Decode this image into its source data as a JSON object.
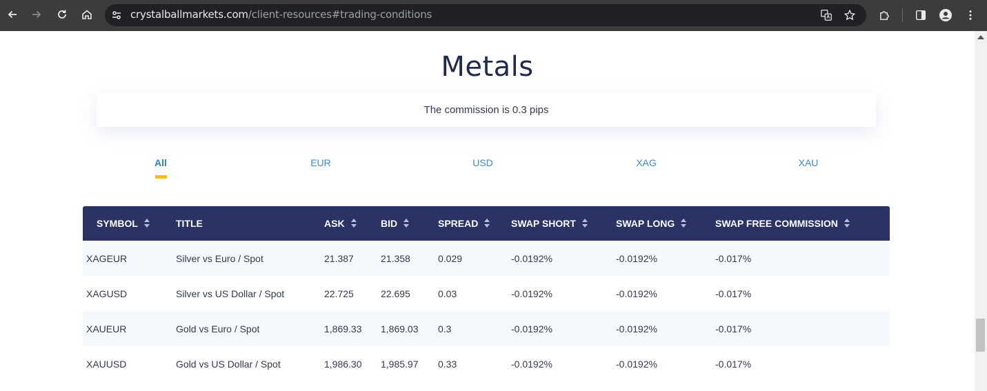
{
  "browser": {
    "url_host": "crystalballmarkets.com",
    "url_path": "/client-resources#trading-conditions"
  },
  "page": {
    "heading": "Metals",
    "commission_text": "The commission is 0.3 pips",
    "tabs": [
      {
        "label": "All",
        "active": true
      },
      {
        "label": "EUR",
        "active": false
      },
      {
        "label": "USD",
        "active": false
      },
      {
        "label": "XAG",
        "active": false
      },
      {
        "label": "XAU",
        "active": false
      }
    ],
    "accent_color": "#f3c211",
    "header_color": "#2b3365"
  },
  "table": {
    "columns": [
      "SYMBOL",
      "TITLE",
      "ASK",
      "BID",
      "SPREAD",
      "SWAP SHORT",
      "SWAP LONG",
      "SWAP FREE COMMISSION"
    ],
    "rows": [
      [
        "XAGEUR",
        "Silver vs Euro / Spot",
        "21.387",
        "21.358",
        "0.029",
        "-0.0192%",
        "-0.0192%",
        "-0.017%"
      ],
      [
        "XAGUSD",
        "Silver vs US Dollar / Spot",
        "22.725",
        "22.695",
        "0.03",
        "-0.0192%",
        "-0.0192%",
        "-0.017%"
      ],
      [
        "XAUEUR",
        "Gold vs Euro / Spot",
        "1,869.33",
        "1,869.03",
        "0.3",
        "-0.0192%",
        "-0.0192%",
        "-0.017%"
      ],
      [
        "XAUUSD",
        "Gold vs US Dollar / Spot",
        "1,986.30",
        "1,985.97",
        "0.33",
        "-0.0192%",
        "-0.0192%",
        "-0.017%"
      ]
    ]
  }
}
